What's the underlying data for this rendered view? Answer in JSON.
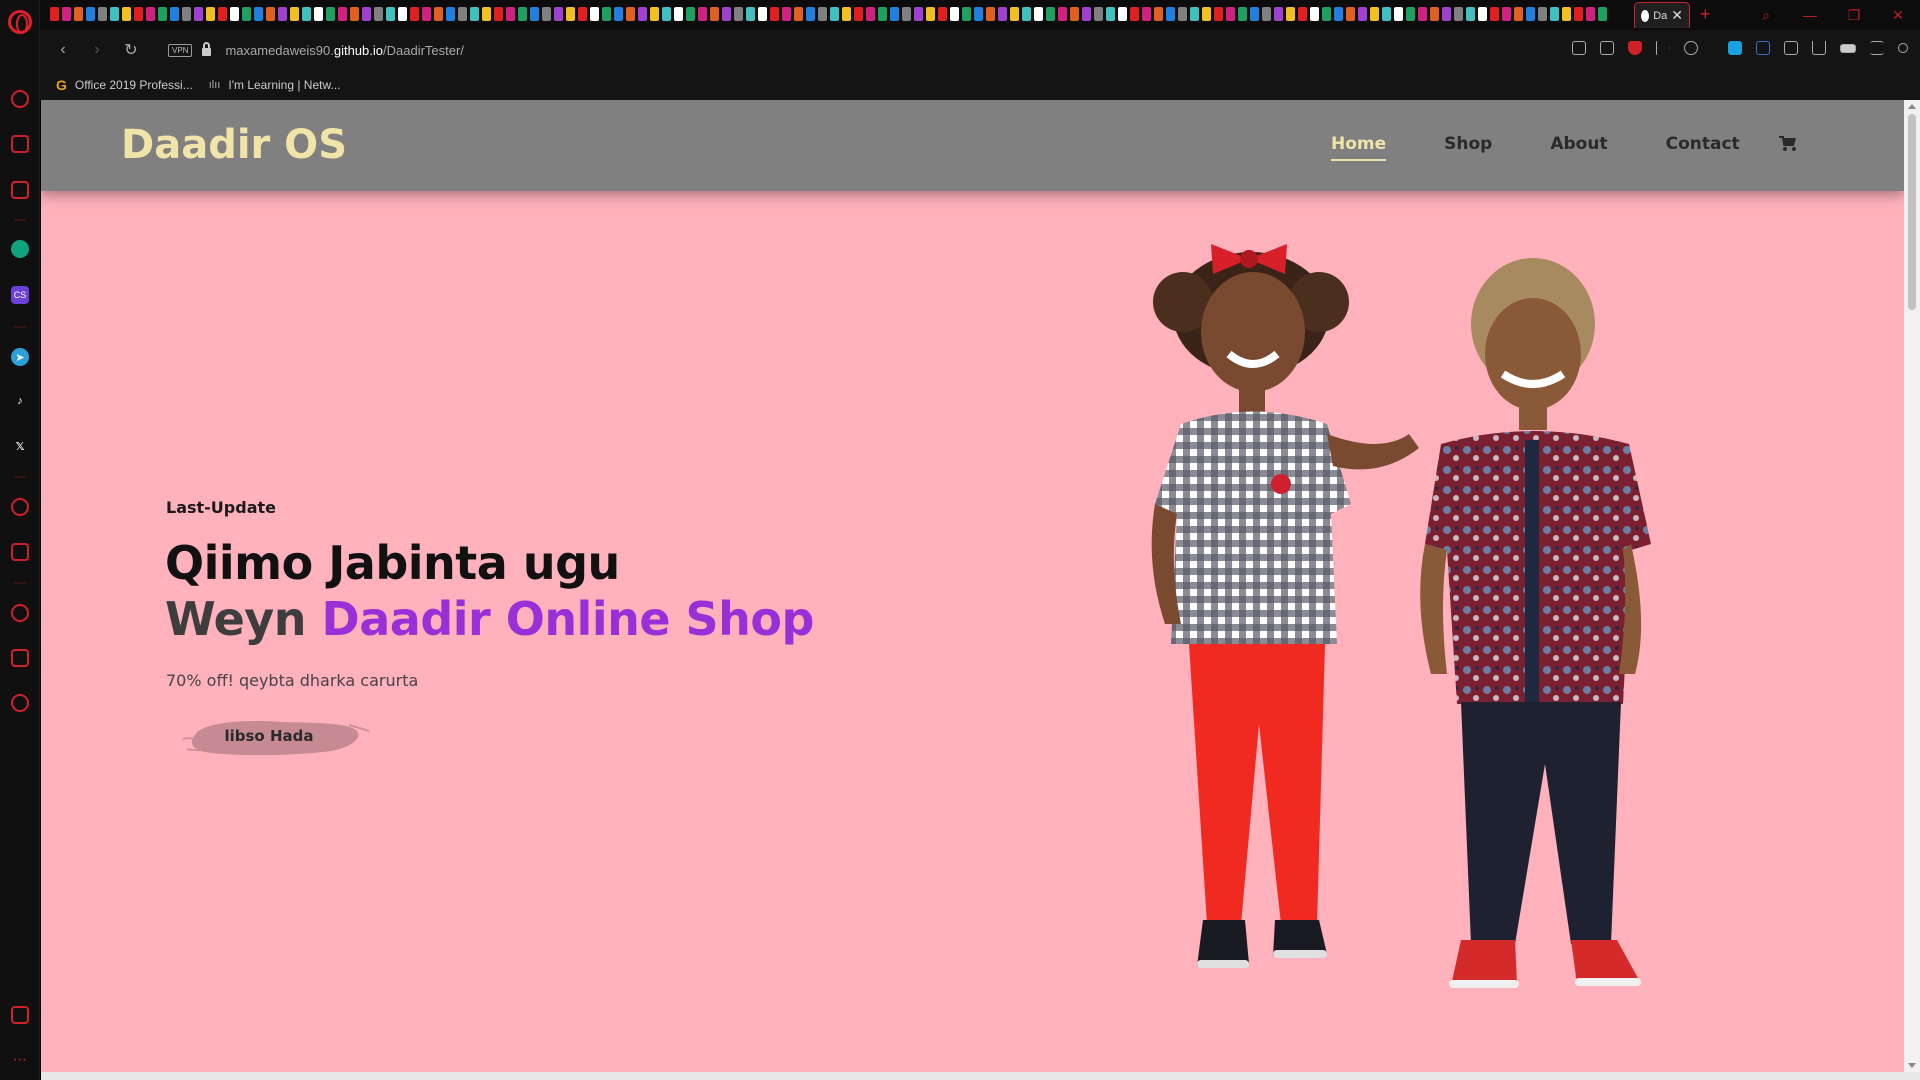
{
  "browser": {
    "active_tab_title": "Da",
    "url_prefix": "maxamedaweis90.",
    "url_domain": "github.io",
    "url_path": "/DaadirTester/",
    "vpn_label": "VPN",
    "bookmarks": [
      {
        "icon": "G",
        "label": "Office 2019 Professi..."
      },
      {
        "icon": "cisco",
        "label": "I'm Learning | Netw..."
      }
    ],
    "window_controls": {
      "minimize": "—",
      "restore": "❐",
      "close": "✕"
    },
    "new_tab": "+"
  },
  "site": {
    "brand": "Daadir OS",
    "nav": [
      {
        "label": "Home",
        "active": true
      },
      {
        "label": "Shop",
        "active": false
      },
      {
        "label": "About",
        "active": false
      },
      {
        "label": "Contact",
        "active": false
      }
    ],
    "cart_icon": "cart-icon"
  },
  "hero": {
    "eyebrow": "Last-Update",
    "title_line1": "Qiimo Jabinta ugu",
    "title_line2_plain": "Weyn ",
    "title_line2_accent": "Daadir Online Shop",
    "subtitle": "70% off! qeybta dharka carurta",
    "cta_label": "libso Hada"
  },
  "colors": {
    "page_bg": "#ffb1bc",
    "header_bg": "#808080",
    "brand": "#f0e4a8",
    "accent_purple": "#9a2fd8",
    "cta_brush": "#c58a92"
  }
}
